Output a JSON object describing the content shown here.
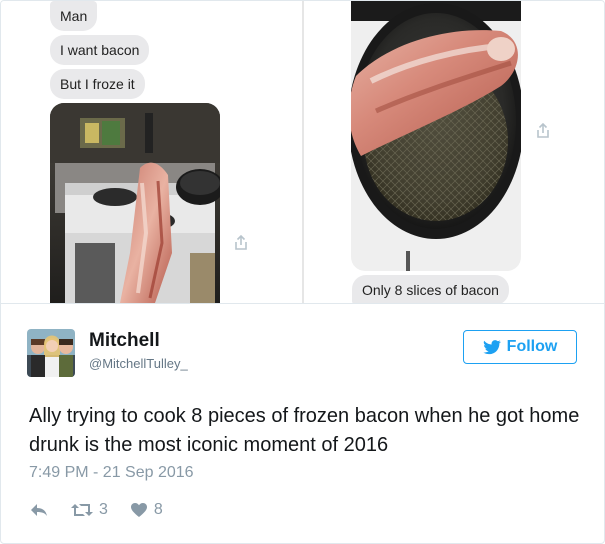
{
  "messages": {
    "bubble1": "Man",
    "bubble2": "I want bacon",
    "bubble3": "But I froze it",
    "caption": "Only 8 slices of bacon"
  },
  "tweet": {
    "name": "Mitchell",
    "handle": "@MitchellTulley_",
    "follow_label": "Follow",
    "text": "Ally trying to cook 8 pieces of frozen bacon when he got home drunk is the most iconic moment of 2016",
    "timestamp": "7:49 PM - 21 Sep 2016",
    "retweets": "3",
    "likes": "8"
  },
  "icons": {
    "reply": "reply-icon",
    "retweet": "retweet-icon",
    "like": "heart-icon",
    "share": "share-icon",
    "bird": "twitter-bird-icon"
  },
  "colors": {
    "accent": "#1da1f2",
    "muted": "#8899a6",
    "text": "#14171a",
    "bubble": "#e9e9eb"
  }
}
